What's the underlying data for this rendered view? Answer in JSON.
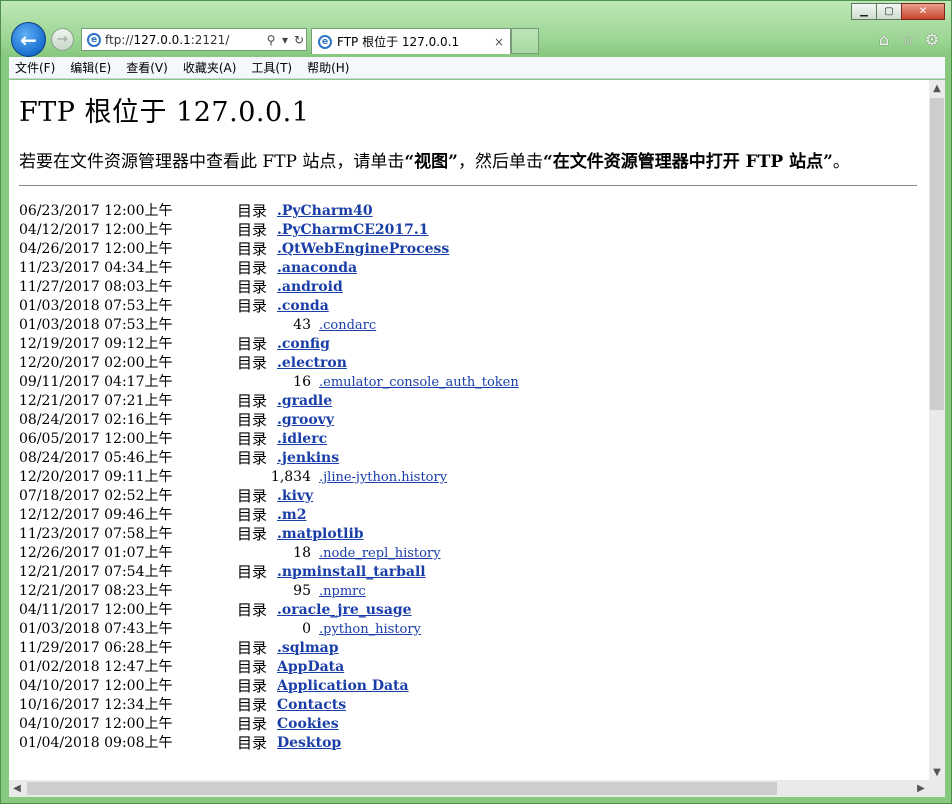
{
  "window": {
    "minimize": "▁",
    "maximize": "▢",
    "close": "✕"
  },
  "address": {
    "prefix": "ftp://",
    "host": "127.0.0.1",
    "port": ":2121/",
    "search_glyph": "⚲",
    "dropdown_glyph": "▾",
    "refresh_glyph": "↻"
  },
  "tab": {
    "title": "FTP 根位于 127.0.0.1",
    "close": "×"
  },
  "menu": [
    "文件(F)",
    "编辑(E)",
    "查看(V)",
    "收藏夹(A)",
    "工具(T)",
    "帮助(H)"
  ],
  "page": {
    "heading": "FTP 根位于 127.0.0.1",
    "desc_pre": "若要在文件资源管理器中查看此 FTP 站点，请单击",
    "desc_b1": "“视图”",
    "desc_mid": "，然后单击",
    "desc_b2": "“在文件资源管理器中打开 FTP 站点”",
    "desc_post": "。"
  },
  "dir_label": "目录",
  "rows": [
    {
      "date": "06/23/2017 12:00上午",
      "dir": true,
      "name": ".PyCharm40"
    },
    {
      "date": "04/12/2017 12:00上午",
      "dir": true,
      "name": ".PyCharmCE2017.1"
    },
    {
      "date": "04/26/2017 12:00上午",
      "dir": true,
      "name": ".QtWebEngineProcess"
    },
    {
      "date": "11/23/2017 04:34上午",
      "dir": true,
      "name": ".anaconda"
    },
    {
      "date": "11/27/2017 08:03上午",
      "dir": true,
      "name": ".android"
    },
    {
      "date": "01/03/2018 07:53上午",
      "dir": true,
      "name": ".conda"
    },
    {
      "date": "01/03/2018 07:53上午",
      "dir": false,
      "size": "43",
      "name": ".condarc"
    },
    {
      "date": "12/19/2017 09:12上午",
      "dir": true,
      "name": ".config"
    },
    {
      "date": "12/20/2017 02:00上午",
      "dir": true,
      "name": ".electron"
    },
    {
      "date": "09/11/2017 04:17上午",
      "dir": false,
      "size": "16",
      "name": ".emulator_console_auth_token"
    },
    {
      "date": "12/21/2017 07:21上午",
      "dir": true,
      "name": ".gradle"
    },
    {
      "date": "08/24/2017 02:16上午",
      "dir": true,
      "name": ".groovy"
    },
    {
      "date": "06/05/2017 12:00上午",
      "dir": true,
      "name": ".idlerc"
    },
    {
      "date": "08/24/2017 05:46上午",
      "dir": true,
      "name": ".jenkins"
    },
    {
      "date": "12/20/2017 09:11上午",
      "dir": false,
      "size": "1,834",
      "name": ".jline-jython.history"
    },
    {
      "date": "07/18/2017 02:52上午",
      "dir": true,
      "name": ".kivy"
    },
    {
      "date": "12/12/2017 09:46上午",
      "dir": true,
      "name": ".m2"
    },
    {
      "date": "11/23/2017 07:58上午",
      "dir": true,
      "name": ".matplotlib"
    },
    {
      "date": "12/26/2017 01:07上午",
      "dir": false,
      "size": "18",
      "name": ".node_repl_history"
    },
    {
      "date": "12/21/2017 07:54上午",
      "dir": true,
      "name": ".npminstall_tarball"
    },
    {
      "date": "12/21/2017 08:23上午",
      "dir": false,
      "size": "95",
      "name": ".npmrc"
    },
    {
      "date": "04/11/2017 12:00上午",
      "dir": true,
      "name": ".oracle_jre_usage"
    },
    {
      "date": "01/03/2018 07:43上午",
      "dir": false,
      "size": "0",
      "name": ".python_history"
    },
    {
      "date": "11/29/2017 06:28上午",
      "dir": true,
      "name": ".sqlmap"
    },
    {
      "date": "01/02/2018 12:47上午",
      "dir": true,
      "name": "AppData"
    },
    {
      "date": "04/10/2017 12:00上午",
      "dir": true,
      "name": "Application Data"
    },
    {
      "date": "10/16/2017 12:34上午",
      "dir": true,
      "name": "Contacts"
    },
    {
      "date": "04/10/2017 12:00上午",
      "dir": true,
      "name": "Cookies"
    },
    {
      "date": "01/04/2018 09:08上午",
      "dir": true,
      "name": "Desktop"
    }
  ]
}
